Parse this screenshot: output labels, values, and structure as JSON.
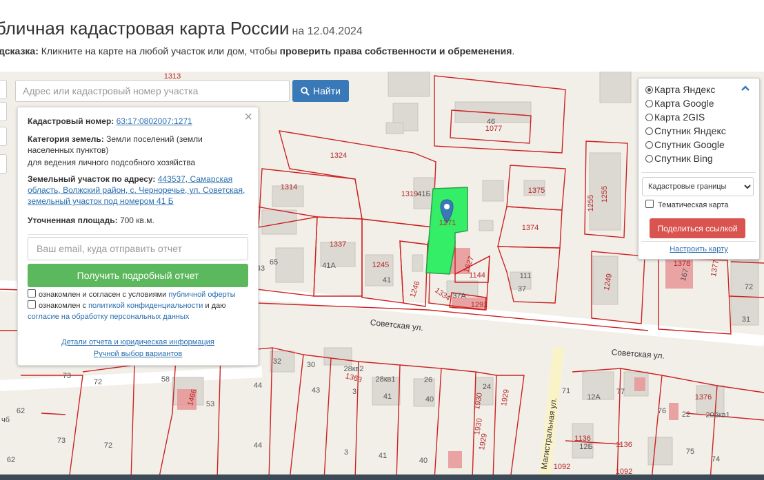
{
  "header": {
    "title": "бличная кадастровая карта России",
    "date": "на 12.04.2024",
    "hint_label": "дсказка:",
    "hint_text": " Кликните на карте на любой участок или дом, чтобы ",
    "hint_bold": "проверить права собственности и обременения",
    "hint_end": "."
  },
  "search": {
    "placeholder": "Адрес или кадастровый номер участка",
    "button_label": "Найти"
  },
  "info_panel": {
    "close": "×",
    "cadastral_label": "Кадастровый номер:",
    "cadastral_number": "63:17:0802007:1271",
    "category_label": "Категория земель:",
    "category_value": "Земли поселений (земли населенных пунктов)",
    "category_use": "для ведения личного подсобного хозяйства",
    "address_label": "Земельный участок по адресу:",
    "address_value": "443537, Самарская область, Волжский район, с. Черноречье, ул. Советская, земельный участок под номером 41 Б",
    "area_label": "Уточненная площадь:",
    "area_value": "700 кв.м.",
    "email_placeholder": "Ваш email, куда отправить отчет",
    "report_button": "Получить подробный отчет",
    "consent1_text": "ознакомлен и согласен с условиями ",
    "consent1_link": "публичной оферты",
    "consent2_text": "ознакомлен с ",
    "consent2_link": "политикой конфиденциальности",
    "consent2_mid": " и даю ",
    "consent2_link2": "согласие на обработку персональных данных",
    "details_link": "Детали отчета и юридическая информация",
    "manual_link": "Ручной выбор вариантов"
  },
  "layers_panel": {
    "options": [
      {
        "label": "Карта Яндекс",
        "selected": true
      },
      {
        "label": "Карта Google",
        "selected": false
      },
      {
        "label": "Карта 2GIS",
        "selected": false
      },
      {
        "label": "Спутник Яндекс",
        "selected": false
      },
      {
        "label": "Спутник Google",
        "selected": false
      },
      {
        "label": "Спутник Bing",
        "selected": false
      }
    ],
    "overlay_select": "Кадастровые границы",
    "thematic_label": "Тематическая карта",
    "share_button": "Поделиться ссылкой",
    "configure_link": "Настроить карту"
  },
  "map": {
    "street_labels": [
      "Советская ул.",
      "Советская ул.",
      "Магистральная ул."
    ],
    "parcel_labels": [
      "1313",
      "46",
      "1077",
      "1324",
      "1314",
      "1319",
      "41Б",
      "1271",
      "1375",
      "1255",
      "1255",
      "1374",
      "1337",
      "41А",
      "65",
      "43",
      "1245",
      "41",
      "1627",
      "1144",
      "111",
      "37",
      "1249",
      "1378",
      "167",
      "1377",
      "72",
      "31",
      "1246",
      "1334",
      "37А",
      "1291",
      "32",
      "30",
      "28кв2",
      "1363",
      "28кв1",
      "26",
      "73",
      "72",
      "58",
      "1466",
      "53",
      "44",
      "43",
      "3",
      "41",
      "40",
      "1930",
      "24",
      "1929",
      "1930",
      "1929",
      "71",
      "12А",
      "77",
      "76",
      "22",
      "1376",
      "20бкв1",
      "62",
      "чб",
      "73",
      "72",
      "44",
      "3",
      "41",
      "40",
      "1136",
      "12Б",
      "1136",
      "75",
      "74",
      "1092",
      "1092",
      "62"
    ]
  },
  "colors": {
    "selected_parcel": "#33ee66",
    "parcel_border": "#cc2222",
    "search_button": "#3a79b8",
    "report_button": "#5cb85c",
    "share_button": "#d9534f",
    "link": "#2a6fb0"
  },
  "icons": [
    "search-icon",
    "close-icon",
    "chevron-up-icon",
    "map-marker-icon"
  ]
}
